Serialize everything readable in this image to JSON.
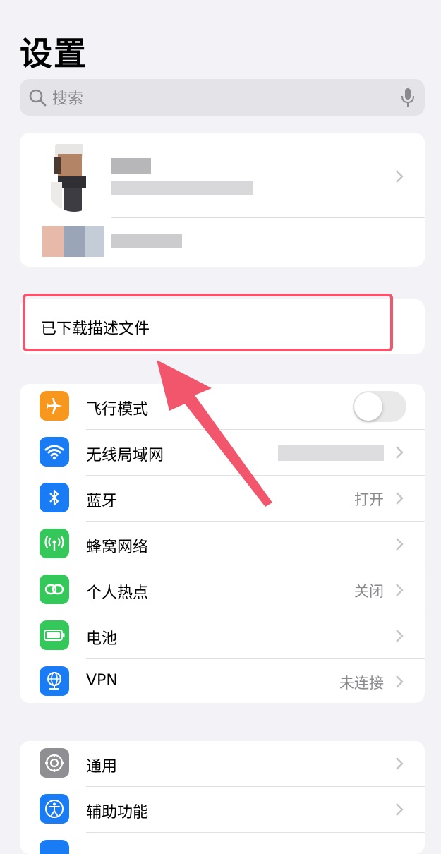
{
  "header": {
    "title": "设置"
  },
  "search": {
    "placeholder": "搜索"
  },
  "profile_file": {
    "label": "已下载描述文件"
  },
  "group1": [
    {
      "label": "飞行模式",
      "icon": "airplane-icon",
      "color": "#f7971e",
      "value": "",
      "toggle": true
    },
    {
      "label": "无线局域网",
      "icon": "wifi-icon",
      "color": "#1a7cf5",
      "value": ""
    },
    {
      "label": "蓝牙",
      "icon": "bluetooth-icon",
      "color": "#1a7cf5",
      "value": "打开"
    },
    {
      "label": "蜂窝网络",
      "icon": "cellular-icon",
      "color": "#34c759",
      "value": ""
    },
    {
      "label": "个人热点",
      "icon": "hotspot-icon",
      "color": "#34c759",
      "value": "关闭"
    },
    {
      "label": "电池",
      "icon": "battery-icon",
      "color": "#34c759",
      "value": ""
    },
    {
      "label": "VPN",
      "icon": "vpn-globe-icon",
      "color": "#1a7cf5",
      "value": "未连接"
    }
  ],
  "group2": [
    {
      "label": "通用",
      "icon": "gear-icon",
      "color": "#8e8e93"
    },
    {
      "label": "辅助功能",
      "icon": "accessibility-icon",
      "color": "#1a7cf5"
    }
  ],
  "annotation": {
    "box_color": "#f2566d",
    "arrow_color": "#f2566d"
  }
}
